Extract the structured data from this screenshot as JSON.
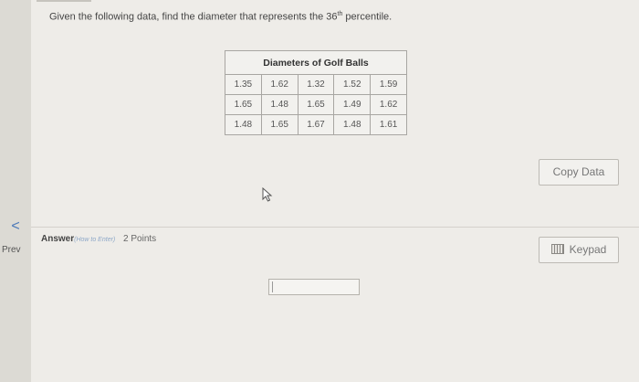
{
  "nav": {
    "prev_chevron": "<",
    "prev_label": "Prev"
  },
  "question": {
    "text_before": "Given the following data, find the diameter that represents the 36",
    "sup": "th",
    "text_after": " percentile."
  },
  "table": {
    "title": "Diameters of Golf Balls",
    "rows": [
      [
        "1.35",
        "1.62",
        "1.32",
        "1.52",
        "1.59"
      ],
      [
        "1.65",
        "1.48",
        "1.65",
        "1.49",
        "1.62"
      ],
      [
        "1.48",
        "1.65",
        "1.67",
        "1.48",
        "1.61"
      ]
    ]
  },
  "buttons": {
    "copy_data": "Copy Data",
    "keypad": "Keypad"
  },
  "answer": {
    "label": "Answer",
    "how_to": "(How to Enter)",
    "points": "2 Points",
    "value": ""
  },
  "icons": {
    "cursor": "mouse-pointer-icon",
    "keypad": "keyboard-icon"
  }
}
